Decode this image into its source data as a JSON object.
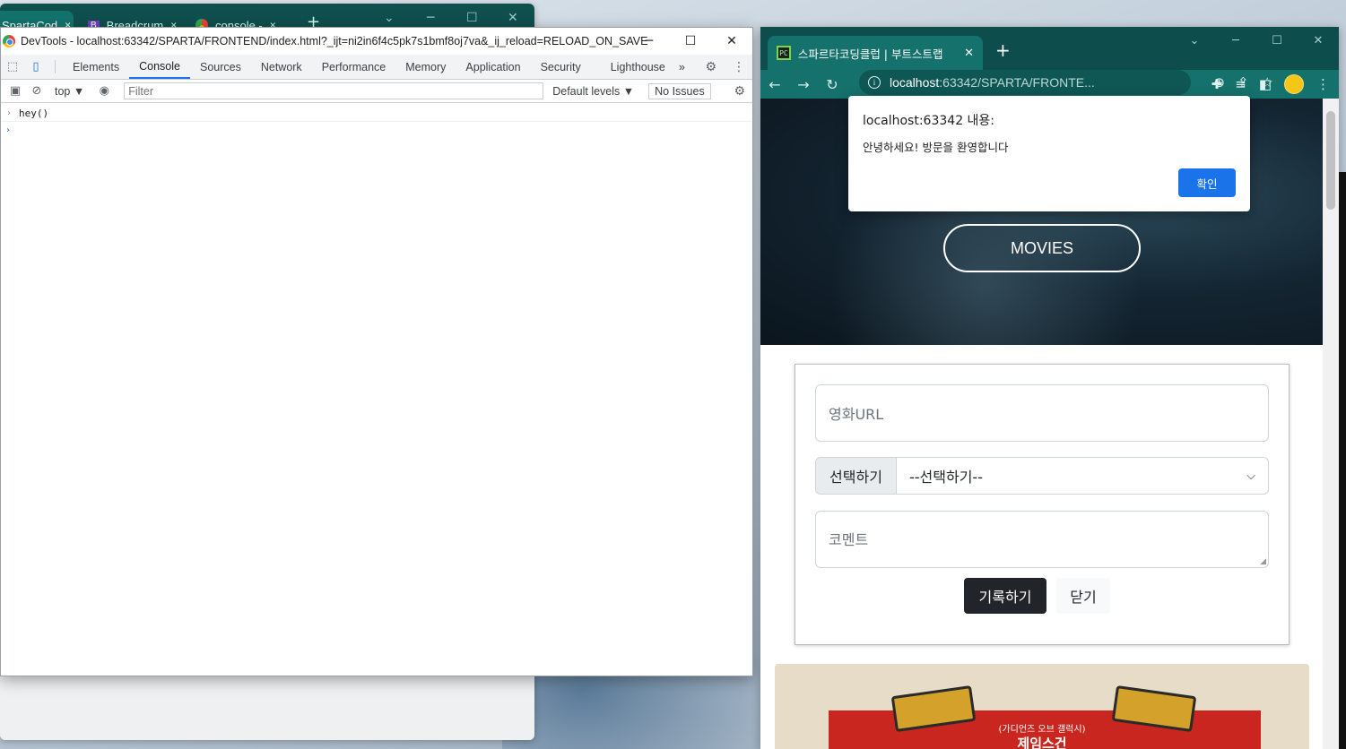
{
  "background_window": {
    "tabs": [
      {
        "label": "SpartaCod",
        "close": "×"
      },
      {
        "label": "Breadcrum",
        "close": "×"
      },
      {
        "label": "console -",
        "close": "×"
      }
    ],
    "new_tab": "+"
  },
  "devtools": {
    "title": "DevTools - localhost:63342/SPARTA/FRONTEND/index.html?_ijt=ni2in6f4c5pk7s1bmf8oj7va&_ij_reload=RELOAD_ON_SAVE",
    "tabs": [
      "Elements",
      "Console",
      "Sources",
      "Network",
      "Performance",
      "Memory",
      "Application",
      "Security",
      "Lighthouse"
    ],
    "active_tab": "Console",
    "more_tabs": "»",
    "context": "top ▼",
    "filter_placeholder": "Filter",
    "default_levels": "Default levels ▼",
    "issues": "No Issues",
    "console_lines": [
      "hey()"
    ]
  },
  "browser": {
    "tab_title": "스파르타코딩클럽 | 부트스트랩",
    "url_host": "localhost",
    "url_rest": ":63342/SPARTA/FRONTE...",
    "page": {
      "hero_button": "MOVIES",
      "url_placeholder": "영화URL",
      "select_addon": "선택하기",
      "select_value": "--선택하기--",
      "comment_placeholder": "코멘트",
      "record_button": "기록하기",
      "close_button": "닫기",
      "poster_caption_top": "(가디언즈 오브 갤럭시)",
      "poster_caption_main": "제임스건"
    }
  },
  "alert": {
    "title": "localhost:63342 내용:",
    "message": "안녕하세요! 방문을 환영합니다",
    "ok_button": "확인"
  },
  "colors": {
    "chrome_theme": "#0d4e4c",
    "devtools_accent": "#1a73e8",
    "dark_button": "#212529"
  }
}
